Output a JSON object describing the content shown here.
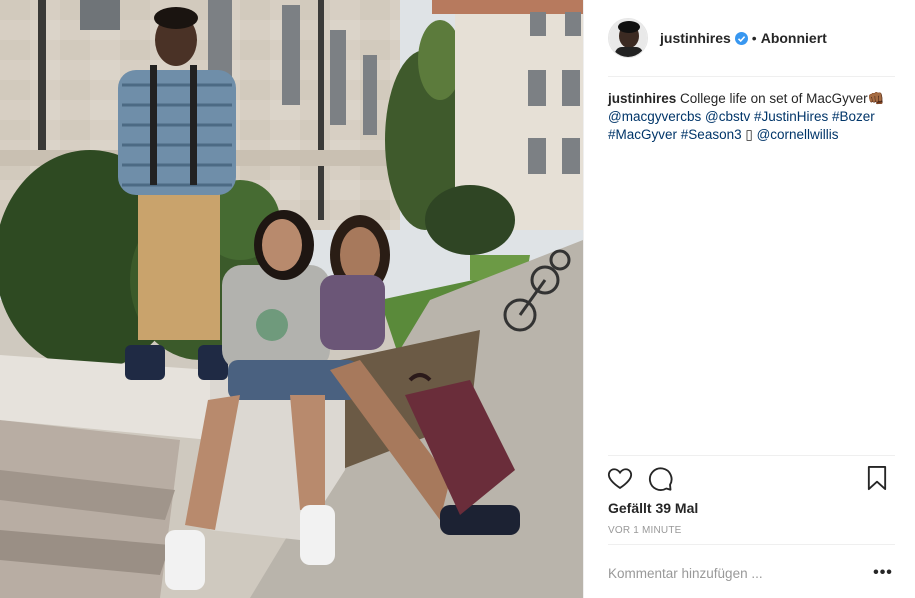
{
  "post": {
    "username": "justinhires",
    "follow_separator": "•",
    "follow_state": "Abonniert",
    "caption": {
      "username": "justinhires",
      "text": "College life on set of MacGyver",
      "emoji": "👊🏾",
      "mention_1": "@macgyvercbs",
      "mention_2": "@cbstv",
      "tag_1": "#JustinHires",
      "tag_2": "#Bozer",
      "tag_3": "#MacGyver",
      "tag_4": "#Season3",
      "box_glyph": "▯",
      "mention_3": "@cornellwillis"
    },
    "likes_text": "Gefällt 39 Mal",
    "timestamp": "VOR 1 MINUTE",
    "comment_placeholder": "Kommentar hinzufügen ...",
    "more_label": "•••"
  },
  "icons": {
    "verified": "verified-badge-icon",
    "like": "heart-icon",
    "comment": "comment-bubble-icon",
    "save": "bookmark-icon",
    "more": "more-options-icon"
  },
  "colors": {
    "verified_blue": "#3897f0",
    "link": "#003569",
    "muted": "#999999",
    "text": "#262626",
    "divider": "#efefef"
  }
}
